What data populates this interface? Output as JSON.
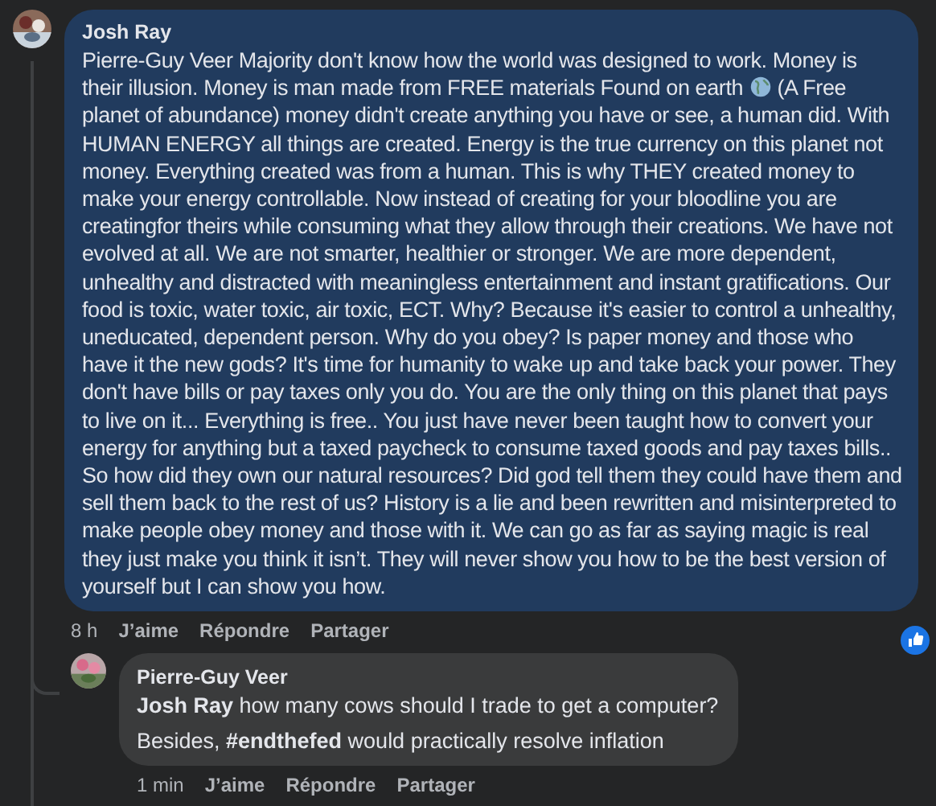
{
  "comment": {
    "author": "Josh Ray",
    "body": [
      "Pierre-Guy Veer Majority don't know how the world was designed to work. Money is their illusion. Money is man made from FREE materials Found on earth",
      "(A Free planet of abundance) money didn't create anything you have or see, a human did. With HUMAN ENERGY all things are created. Energy is the true currency on this planet not money. Everything created was from a human. This is why THEY created money to make your energy controllable. Now instead of creating for your bloodline you are creatingfor theirs while consuming what they allow through their creations. We have not evolved at all. We are not smarter, healthier or stronger. We are more dependent, unhealthy and distracted with meaningless entertainment and instant gratifications. Our food is toxic, water toxic, air toxic, ECT. Why? Because it's easier to control a unhealthy, uneducated, dependent person. Why do you obey? Is paper money and those who have it the new gods? It's time for humanity to wake up and take back your power. They don't have bills or pay taxes only you do. You are the only thing on this planet that pays to live on it... Everything is free.. You just have never been taught how to convert your energy for anything but a taxed paycheck to consume taxed goods and pay taxes bills.. So how did they own our natural resources? Did god tell them they could have them and sell them back to the rest of us? History is a lie and been rewritten and misinterpreted to make people obey money and those with it. We can go as far as saying magic is real they just make you think it isn’t. They will never show you how to be the best version of yourself but I can show you how."
    ],
    "time": "8 h",
    "actions": [
      "J’aime",
      "Répondre",
      "Partager"
    ],
    "liked": true
  },
  "reply": {
    "author": "Pierre-Guy Veer",
    "lines": [
      "**Josh Ray** how many cows should I trade to get a computer?",
      "Besides, **#endthefed** would practically resolve inflation"
    ],
    "time": "1 min",
    "actions": [
      "J’aime",
      "Répondre",
      "Partager"
    ]
  }
}
